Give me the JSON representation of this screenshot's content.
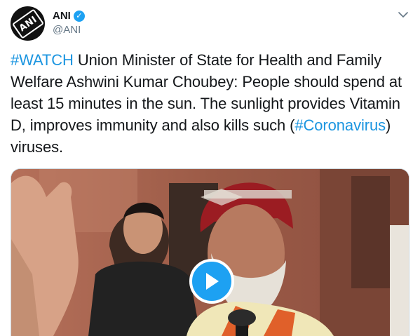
{
  "author": {
    "display_name": "ANI",
    "handle": "@ANI",
    "verified": true,
    "avatar_text": "ANI"
  },
  "icons": {
    "verified": "verified-badge-icon",
    "menu": "chevron-down-icon",
    "play": "play-icon"
  },
  "tweet": {
    "hashtag_watch": "#WATCH",
    "text_part1": " Union Minister of State for Health and Family Welfare Ashwini Kumar Choubey: People should spend at least 15 minutes in the sun. The sunlight provides Vitamin D, improves immunity and also kills such (",
    "hashtag_coronavirus": "#Coronavirus",
    "text_part2": ") viruses."
  },
  "colors": {
    "link": "#1b95e0",
    "accent": "#1da1f2",
    "secondary_text": "#657786"
  }
}
